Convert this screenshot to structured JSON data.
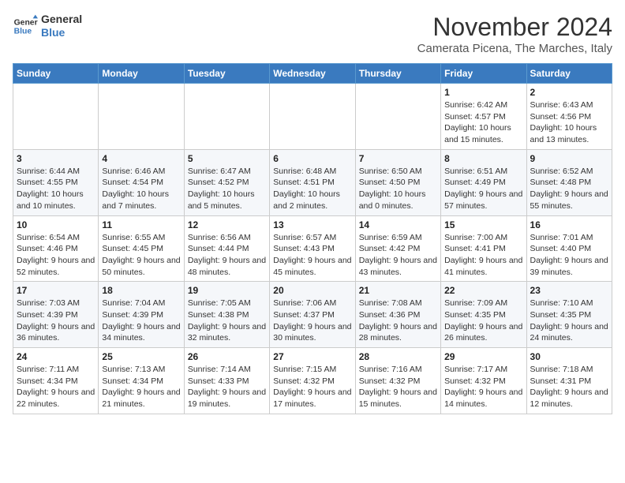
{
  "header": {
    "logo_line1": "General",
    "logo_line2": "Blue",
    "month_year": "November 2024",
    "location": "Camerata Picena, The Marches, Italy"
  },
  "weekdays": [
    "Sunday",
    "Monday",
    "Tuesday",
    "Wednesday",
    "Thursday",
    "Friday",
    "Saturday"
  ],
  "weeks": [
    [
      {
        "day": "",
        "info": ""
      },
      {
        "day": "",
        "info": ""
      },
      {
        "day": "",
        "info": ""
      },
      {
        "day": "",
        "info": ""
      },
      {
        "day": "",
        "info": ""
      },
      {
        "day": "1",
        "info": "Sunrise: 6:42 AM\nSunset: 4:57 PM\nDaylight: 10 hours and 15 minutes."
      },
      {
        "day": "2",
        "info": "Sunrise: 6:43 AM\nSunset: 4:56 PM\nDaylight: 10 hours and 13 minutes."
      }
    ],
    [
      {
        "day": "3",
        "info": "Sunrise: 6:44 AM\nSunset: 4:55 PM\nDaylight: 10 hours and 10 minutes."
      },
      {
        "day": "4",
        "info": "Sunrise: 6:46 AM\nSunset: 4:54 PM\nDaylight: 10 hours and 7 minutes."
      },
      {
        "day": "5",
        "info": "Sunrise: 6:47 AM\nSunset: 4:52 PM\nDaylight: 10 hours and 5 minutes."
      },
      {
        "day": "6",
        "info": "Sunrise: 6:48 AM\nSunset: 4:51 PM\nDaylight: 10 hours and 2 minutes."
      },
      {
        "day": "7",
        "info": "Sunrise: 6:50 AM\nSunset: 4:50 PM\nDaylight: 10 hours and 0 minutes."
      },
      {
        "day": "8",
        "info": "Sunrise: 6:51 AM\nSunset: 4:49 PM\nDaylight: 9 hours and 57 minutes."
      },
      {
        "day": "9",
        "info": "Sunrise: 6:52 AM\nSunset: 4:48 PM\nDaylight: 9 hours and 55 minutes."
      }
    ],
    [
      {
        "day": "10",
        "info": "Sunrise: 6:54 AM\nSunset: 4:46 PM\nDaylight: 9 hours and 52 minutes."
      },
      {
        "day": "11",
        "info": "Sunrise: 6:55 AM\nSunset: 4:45 PM\nDaylight: 9 hours and 50 minutes."
      },
      {
        "day": "12",
        "info": "Sunrise: 6:56 AM\nSunset: 4:44 PM\nDaylight: 9 hours and 48 minutes."
      },
      {
        "day": "13",
        "info": "Sunrise: 6:57 AM\nSunset: 4:43 PM\nDaylight: 9 hours and 45 minutes."
      },
      {
        "day": "14",
        "info": "Sunrise: 6:59 AM\nSunset: 4:42 PM\nDaylight: 9 hours and 43 minutes."
      },
      {
        "day": "15",
        "info": "Sunrise: 7:00 AM\nSunset: 4:41 PM\nDaylight: 9 hours and 41 minutes."
      },
      {
        "day": "16",
        "info": "Sunrise: 7:01 AM\nSunset: 4:40 PM\nDaylight: 9 hours and 39 minutes."
      }
    ],
    [
      {
        "day": "17",
        "info": "Sunrise: 7:03 AM\nSunset: 4:39 PM\nDaylight: 9 hours and 36 minutes."
      },
      {
        "day": "18",
        "info": "Sunrise: 7:04 AM\nSunset: 4:39 PM\nDaylight: 9 hours and 34 minutes."
      },
      {
        "day": "19",
        "info": "Sunrise: 7:05 AM\nSunset: 4:38 PM\nDaylight: 9 hours and 32 minutes."
      },
      {
        "day": "20",
        "info": "Sunrise: 7:06 AM\nSunset: 4:37 PM\nDaylight: 9 hours and 30 minutes."
      },
      {
        "day": "21",
        "info": "Sunrise: 7:08 AM\nSunset: 4:36 PM\nDaylight: 9 hours and 28 minutes."
      },
      {
        "day": "22",
        "info": "Sunrise: 7:09 AM\nSunset: 4:35 PM\nDaylight: 9 hours and 26 minutes."
      },
      {
        "day": "23",
        "info": "Sunrise: 7:10 AM\nSunset: 4:35 PM\nDaylight: 9 hours and 24 minutes."
      }
    ],
    [
      {
        "day": "24",
        "info": "Sunrise: 7:11 AM\nSunset: 4:34 PM\nDaylight: 9 hours and 22 minutes."
      },
      {
        "day": "25",
        "info": "Sunrise: 7:13 AM\nSunset: 4:34 PM\nDaylight: 9 hours and 21 minutes."
      },
      {
        "day": "26",
        "info": "Sunrise: 7:14 AM\nSunset: 4:33 PM\nDaylight: 9 hours and 19 minutes."
      },
      {
        "day": "27",
        "info": "Sunrise: 7:15 AM\nSunset: 4:32 PM\nDaylight: 9 hours and 17 minutes."
      },
      {
        "day": "28",
        "info": "Sunrise: 7:16 AM\nSunset: 4:32 PM\nDaylight: 9 hours and 15 minutes."
      },
      {
        "day": "29",
        "info": "Sunrise: 7:17 AM\nSunset: 4:32 PM\nDaylight: 9 hours and 14 minutes."
      },
      {
        "day": "30",
        "info": "Sunrise: 7:18 AM\nSunset: 4:31 PM\nDaylight: 9 hours and 12 minutes."
      }
    ]
  ]
}
